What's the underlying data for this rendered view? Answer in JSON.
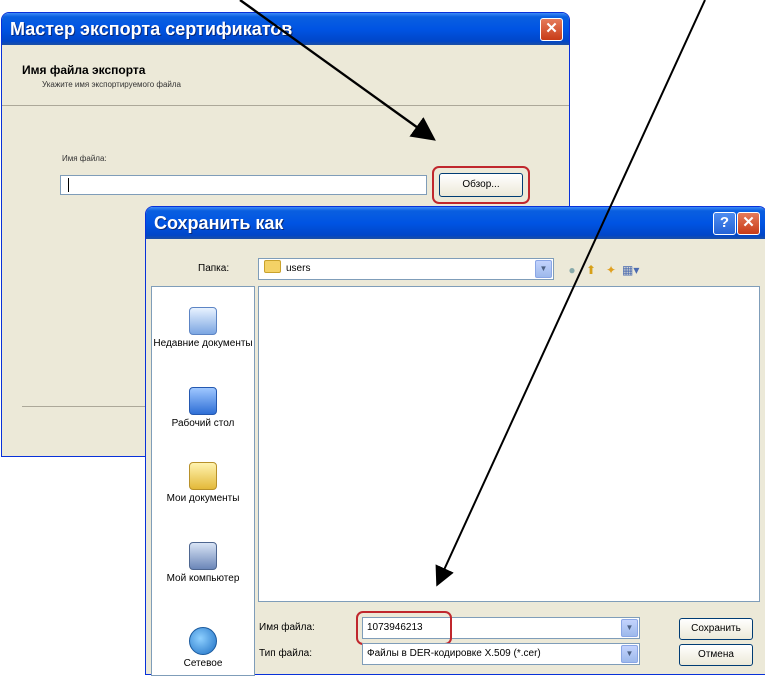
{
  "wizard": {
    "title": "Мастер экспорта сертификатов",
    "header_title": "Имя файла экспорта",
    "header_subtitle": "Укажите имя экспортируемого файла",
    "filename_label": "Имя файла:",
    "filename_value": "",
    "browse_label": "Обзор..."
  },
  "save_dialog": {
    "title": "Сохранить как",
    "folder_label": "Папка:",
    "folder_value": "users",
    "places": [
      {
        "label": "Недавние документы",
        "icon": "recent-documents-icon"
      },
      {
        "label": "Рабочий стол",
        "icon": "desktop-icon"
      },
      {
        "label": "Мои документы",
        "icon": "my-documents-icon"
      },
      {
        "label": "Мой компьютер",
        "icon": "my-computer-icon"
      },
      {
        "label": "Сетевое",
        "icon": "network-icon"
      }
    ],
    "filename_label": "Имя файла:",
    "filename_value": "1073946213",
    "filetype_label": "Тип файла:",
    "filetype_value": "Файлы в DER-кодировке X.509 (*.cer)",
    "save_label": "Сохранить",
    "cancel_label": "Отмена"
  },
  "colors": {
    "titlebar": "#0054e3",
    "dialog_bg": "#ece9d8",
    "highlight": "#c0272d",
    "arrow": "#000000"
  }
}
